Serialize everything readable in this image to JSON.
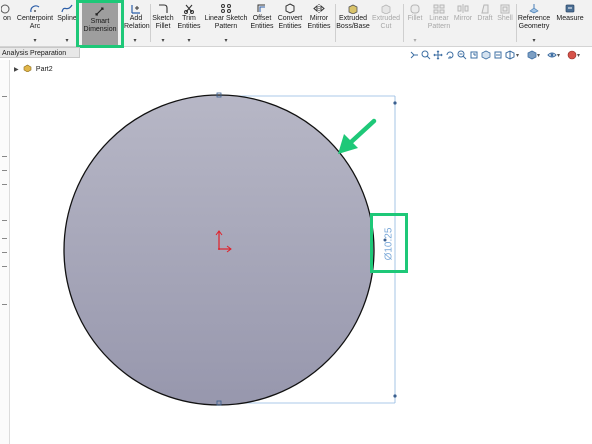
{
  "toolbar": {
    "items": [
      {
        "label1": "on",
        "label2": ""
      },
      {
        "label1": "Centerpoint",
        "label2": "Arc"
      },
      {
        "label1": "Spline",
        "label2": ""
      },
      {
        "label1": "Smart",
        "label2": "Dimension"
      },
      {
        "label1": "Add",
        "label2": "Relation"
      },
      {
        "label1": "Sketch",
        "label2": "Fillet"
      },
      {
        "label1": "Trim",
        "label2": "Entities"
      },
      {
        "label1": "Linear Sketch",
        "label2": "Pattern"
      },
      {
        "label1": "Offset",
        "label2": "Entities"
      },
      {
        "label1": "Convert",
        "label2": "Entities"
      },
      {
        "label1": "Mirror",
        "label2": "Entities"
      },
      {
        "label1": "Extruded",
        "label2": "Boss/Base"
      },
      {
        "label1": "Extruded",
        "label2": "Cut"
      },
      {
        "label1": "Fillet",
        "label2": ""
      },
      {
        "label1": "Linear",
        "label2": "Pattern"
      },
      {
        "label1": "Mirror",
        "label2": ""
      },
      {
        "label1": "Draft",
        "label2": ""
      },
      {
        "label1": "Shell",
        "label2": ""
      },
      {
        "label1": "Reference",
        "label2": "Geometry"
      },
      {
        "label1": "Measure",
        "label2": ""
      }
    ]
  },
  "tab": {
    "label": "Analysis Preparation"
  },
  "tree": {
    "part_name": "Part2"
  },
  "dimension": {
    "text": "Ø10.25"
  },
  "colors": {
    "highlight": "#1ec878",
    "circle_fill": "#a6a6b8",
    "dimension": "#7aa8d8",
    "origin": "#e0202a"
  },
  "icons": [
    "smart-dimension-icon",
    "arrow-indicator",
    "origin-icon",
    "part-icon"
  ]
}
